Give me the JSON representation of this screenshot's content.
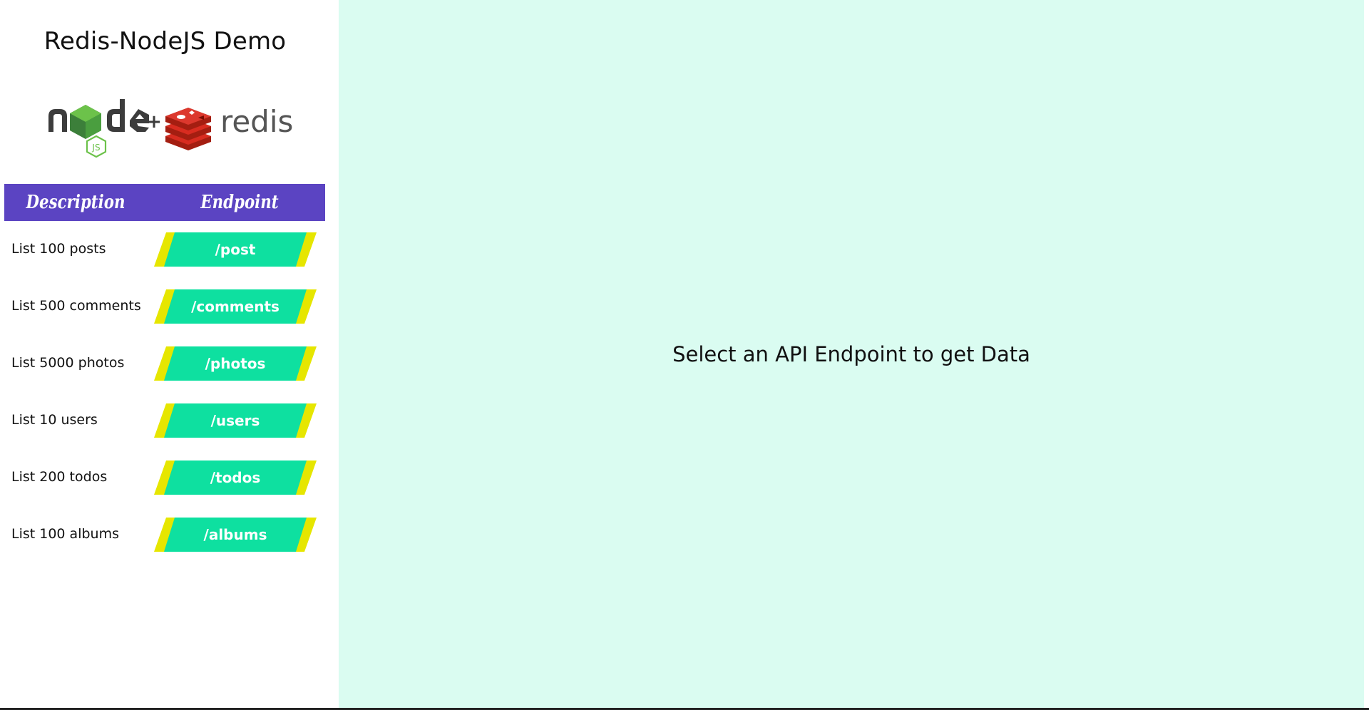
{
  "sidebar": {
    "title": "Redis-NodeJS Demo",
    "logo": {
      "node_text": "node",
      "js_badge": "JS",
      "plus": "+",
      "redis_text": "redis"
    },
    "table": {
      "headers": {
        "description": "Description",
        "endpoint": "Endpoint"
      },
      "rows": [
        {
          "description": "List 100 posts",
          "endpoint": "/post"
        },
        {
          "description": "List 500 comments",
          "endpoint": "/comments"
        },
        {
          "description": "List 5000 photos",
          "endpoint": "/photos"
        },
        {
          "description": "List 10 users",
          "endpoint": "/users"
        },
        {
          "description": "List 200 todos",
          "endpoint": "/todos"
        },
        {
          "description": "List 100 albums",
          "endpoint": "/albums"
        }
      ]
    }
  },
  "main": {
    "placeholder": "Select an API Endpoint to get Data"
  },
  "colors": {
    "header_bg": "#5b44c2",
    "endpoint_button": "#0ee0a0",
    "endpoint_stripe": "#e6e600",
    "main_bg": "#dafcf1"
  }
}
